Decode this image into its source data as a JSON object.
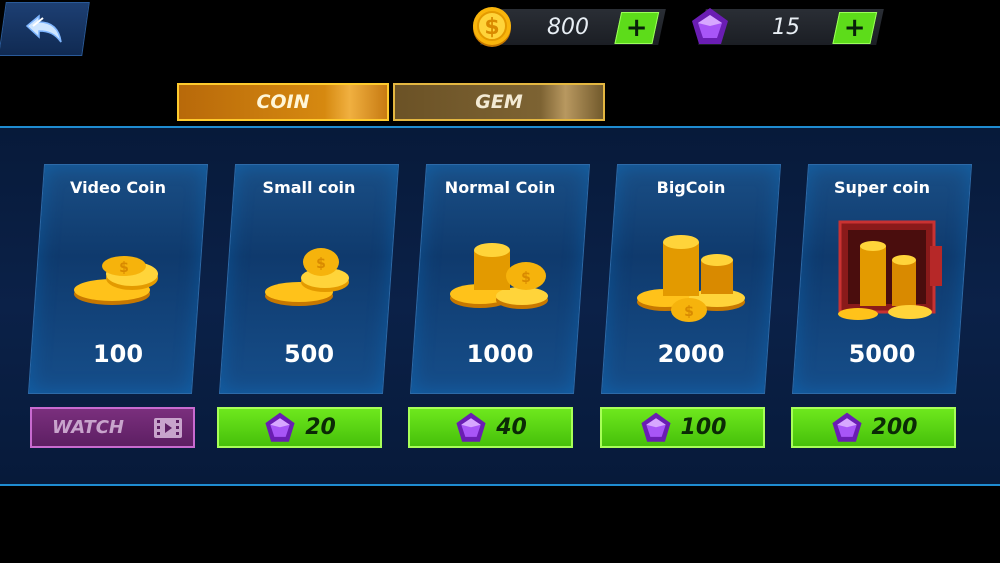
{
  "header": {
    "coin_balance": "800",
    "gem_balance": "15",
    "plus_label": "+"
  },
  "tabs": [
    {
      "label": "COIN",
      "active": true
    },
    {
      "label": "GEM",
      "active": false
    }
  ],
  "cards": [
    {
      "title": "Video Coin",
      "amount": "100",
      "price_label": "WATCH",
      "price_type": "video"
    },
    {
      "title": "Small coin",
      "amount": "500",
      "price_label": "20",
      "price_type": "gem"
    },
    {
      "title": "Normal Coin",
      "amount": "1000",
      "price_label": "40",
      "price_type": "gem"
    },
    {
      "title": "BigCoin",
      "amount": "2000",
      "price_label": "100",
      "price_type": "gem"
    },
    {
      "title": "Super coin",
      "amount": "5000",
      "price_label": "200",
      "price_type": "gem"
    }
  ],
  "colors": {
    "accent_green": "#5ddc1a",
    "gold": "#f5b301",
    "gem_purple": "#8e3ad6",
    "panel_border": "#1f8cd1"
  },
  "icons": {
    "back": "back-arrow-icon",
    "coin": "coin-icon",
    "gem": "gem-icon",
    "video": "film-icon"
  }
}
